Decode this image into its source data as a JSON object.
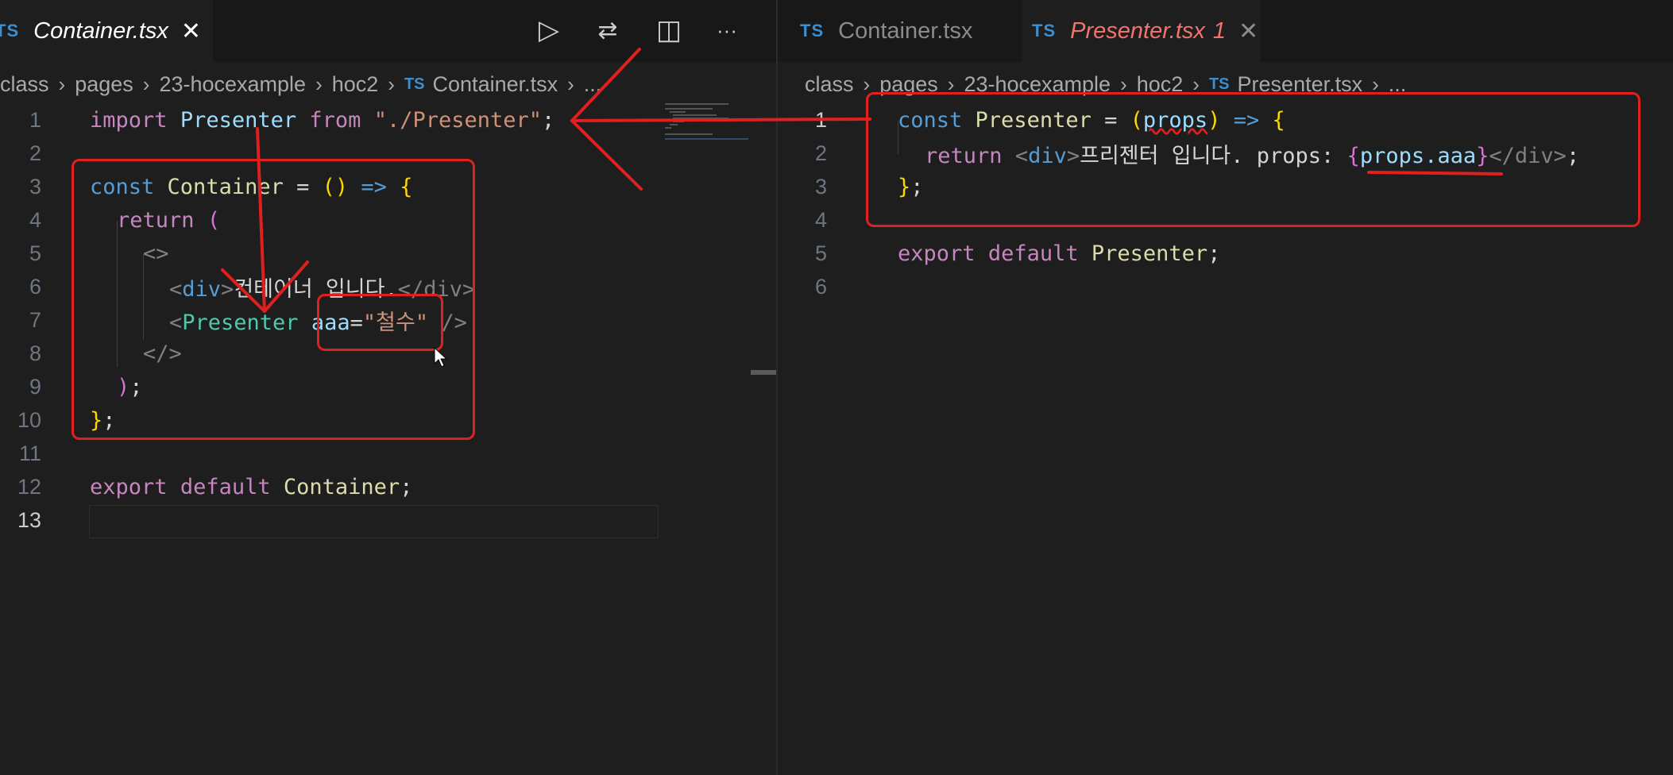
{
  "left": {
    "tab": {
      "ts": "TS",
      "label": "Container.tsx",
      "close": "✕"
    },
    "breadcrumb": [
      "class",
      "pages",
      "23-hocexample",
      "hoc2"
    ],
    "breadcrumb_file": "Container.tsx",
    "breadcrumb_ts": "TS",
    "breadcrumb_more": "...",
    "line_numbers": [
      "1",
      "2",
      "3",
      "4",
      "5",
      "6",
      "7",
      "8",
      "9",
      "10",
      "11",
      "12",
      "13"
    ],
    "code": {
      "l1": {
        "kw": "import",
        "cls": "Presenter",
        "from": "from",
        "str": "\"./Presenter\"",
        "semi": ";"
      },
      "l3": {
        "kw": "const",
        "name": "Container",
        "eq": " = ",
        "paren": "()",
        "arrow": " => ",
        "brace": "{"
      },
      "l4": {
        "kw": "return",
        "paren": "("
      },
      "l5": {
        "frag": "<>"
      },
      "l6": {
        "open": "<",
        "tag": "div",
        "gt": ">",
        "text": "컨테이너 입니다.",
        "close": "</div>"
      },
      "l7": {
        "open": "<",
        "comp": "Presenter",
        "attr": "aaa",
        "eq": "=",
        "val": "\"철수\"",
        "end": " />"
      },
      "l8": {
        "frag": "</>"
      },
      "l9": {
        "paren": ")",
        "semi": ";"
      },
      "l10": {
        "brace": "}",
        "semi": ";"
      },
      "l12": {
        "kw": "export",
        "kw2": "default",
        "name": "Container",
        "semi": ";"
      }
    }
  },
  "right": {
    "tab_inactive": {
      "ts": "TS",
      "label": "Container.tsx"
    },
    "tab_active": {
      "ts": "TS",
      "label": "Presenter.tsx",
      "problems": "1",
      "close": "✕"
    },
    "breadcrumb": [
      "class",
      "pages",
      "23-hocexample",
      "hoc2"
    ],
    "breadcrumb_file": "Presenter.tsx",
    "breadcrumb_ts": "TS",
    "breadcrumb_more": "...",
    "line_numbers": [
      "1",
      "2",
      "3",
      "4",
      "5",
      "6"
    ],
    "code": {
      "l1": {
        "kw": "const",
        "name": "Presenter",
        "eq": " = ",
        "p1": "(",
        "param": "props",
        "p2": ")",
        "arrow": " => ",
        "brace": "{"
      },
      "l2": {
        "kw": "return",
        "open": "<",
        "tag": "div",
        "gt": ">",
        "text": "프리젠터 입니다. props: ",
        "b1": "{",
        "expr": "props.aaa",
        "b2": "}",
        "close": "</div>",
        "semi": ";"
      },
      "l3": {
        "brace": "}",
        "semi": ";"
      },
      "l5": {
        "kw": "export",
        "kw2": "default",
        "name": "Presenter",
        "semi": ";"
      }
    }
  },
  "toolbar": {
    "run": "▷",
    "compare": "⇄",
    "split": "◫",
    "more": "···"
  },
  "colors": {
    "background": "#1e1e1e",
    "annotation": "#e0201f",
    "keyword": "#c586c0",
    "string": "#ce9178"
  }
}
